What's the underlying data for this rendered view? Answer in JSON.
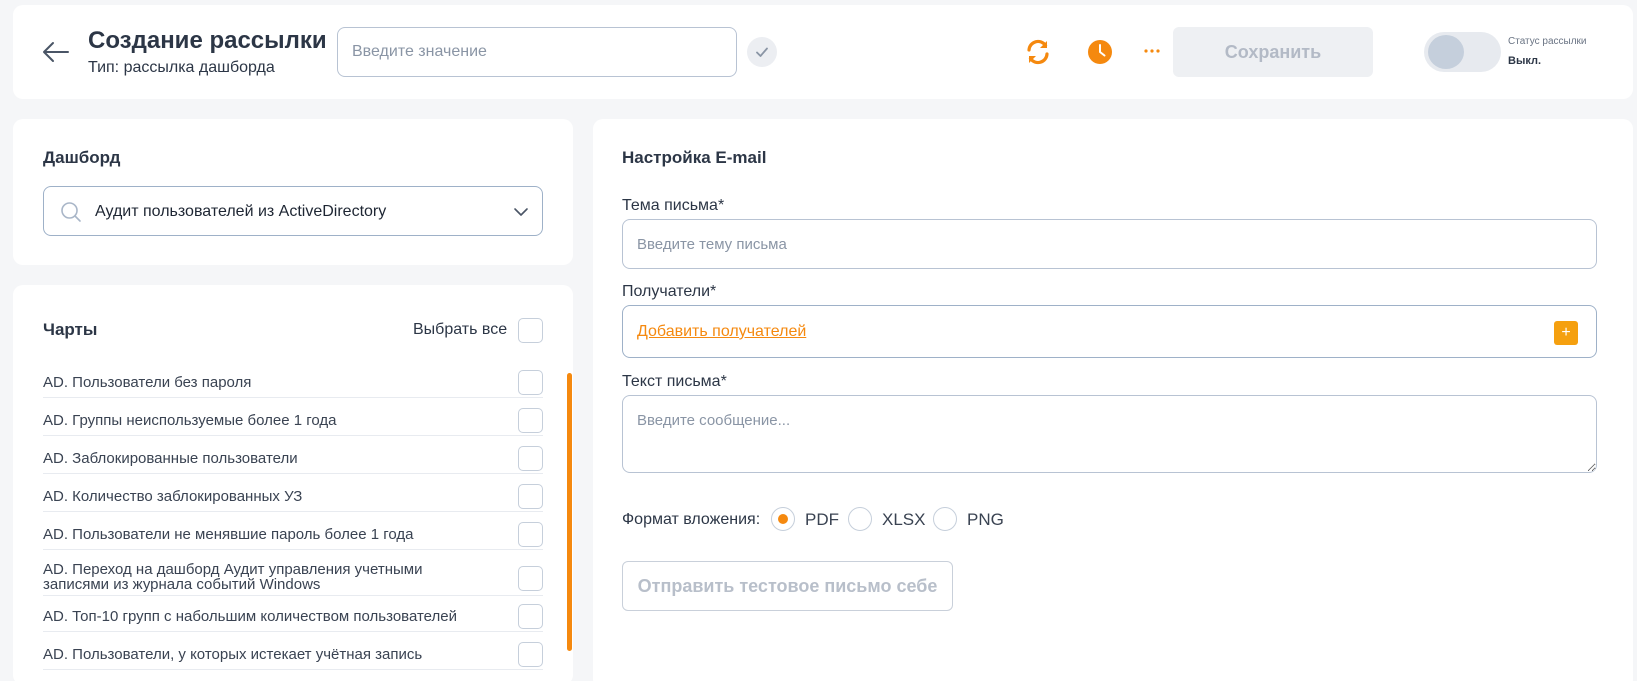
{
  "header": {
    "title": "Создание рассылки",
    "subtitle": "Тип: рассылка дашборда",
    "name_placeholder": "Введите значение",
    "more_label": "···",
    "save_label": "Сохранить",
    "status_label": "Статус рассылки",
    "status_value": "Выкл.",
    "status_on": false
  },
  "dashboard": {
    "title": "Дашборд",
    "selected": "Аудит пользователей из ActiveDirectory"
  },
  "charts": {
    "title": "Чарты",
    "select_all_label": "Выбрать все",
    "items": [
      {
        "label": "AD. Пользователи без пароля",
        "checked": false
      },
      {
        "label": "AD. Группы неиспользуемые более 1 года",
        "checked": false
      },
      {
        "label": "AD. Заблокированные пользователи",
        "checked": false
      },
      {
        "label": "AD. Количество заблокированных УЗ",
        "checked": false
      },
      {
        "label": "AD. Пользователи не менявшие пароль более 1 года",
        "checked": false
      },
      {
        "label": "AD. Переход на дашборд Аудит управления учетными записями из журнала событий Windows",
        "checked": false
      },
      {
        "label": "AD. Топ-10 групп с набольшим количеством пользователей",
        "checked": false
      },
      {
        "label": "AD. Пользователи, у которых истекает учётная запись",
        "checked": false
      }
    ]
  },
  "email": {
    "title": "Настройка E-mail",
    "subject_label": "Тема письма*",
    "subject_placeholder": "Введите тему письма",
    "recipients_label": "Получатели*",
    "add_recipients_label": "Добавить получателей",
    "add_icon": "+",
    "body_label": "Текст письма*",
    "body_placeholder": "Введите сообщение...",
    "format_label": "Формат вложения:",
    "formats": [
      {
        "label": "PDF",
        "checked": true
      },
      {
        "label": "XLSX",
        "checked": false
      },
      {
        "label": "PNG",
        "checked": false
      }
    ],
    "test_button_label": "Отправить тестовое письмо себе"
  },
  "colors": {
    "accent": "#f5890f",
    "background": "#f5f6f8",
    "card": "#ffffff",
    "text": "#2c3646"
  },
  "icons": {
    "back": "arrow-left-icon",
    "confirm": "check-icon",
    "refresh": "refresh-icon",
    "schedule": "clock-icon",
    "more": "more-dots-icon",
    "search": "search-icon",
    "dropdown": "chevron-down-icon",
    "add": "plus-icon"
  }
}
